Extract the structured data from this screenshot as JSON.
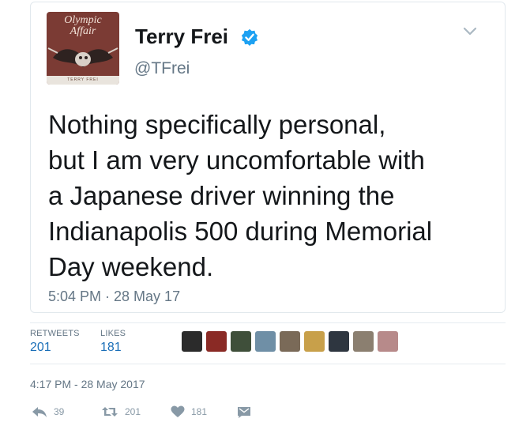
{
  "tweet": {
    "avatar": {
      "logo_text_line1": "Olympic",
      "logo_text_line2": "Affair",
      "footer_text": "TERRY FREI"
    },
    "display_name": "Terry Frei",
    "handle": "@TFrei",
    "verified": true,
    "text_lines": [
      "Nothing specifically personal,",
      "but I am very uncomfortable with",
      "a Japanese driver winning the",
      "Indianapolis 500 during Memorial",
      "Day weekend."
    ],
    "time": "5:04 PM · 28 May 17"
  },
  "stats": {
    "retweets_label": "RETWEETS",
    "retweets_value": "201",
    "likes_label": "LIKES",
    "likes_value": "181",
    "liker_avatars": [
      {
        "name": "liker-1",
        "color": "#2b2b2b"
      },
      {
        "name": "liker-2",
        "color": "#8a2a25"
      },
      {
        "name": "liker-3",
        "color": "#3f4f3a"
      },
      {
        "name": "liker-4",
        "color": "#6f8fa6"
      },
      {
        "name": "liker-5",
        "color": "#7a6a58"
      },
      {
        "name": "liker-6",
        "color": "#c8a04a"
      },
      {
        "name": "liker-7",
        "color": "#2e3640"
      },
      {
        "name": "liker-8",
        "color": "#8b7f70"
      },
      {
        "name": "liker-9",
        "color": "#b78a8a"
      }
    ]
  },
  "footer": {
    "timestamp": "4:17 PM - 28 May 2017",
    "reply_count": "39",
    "retweet_count": "201",
    "like_count": "181"
  },
  "colors": {
    "link_blue": "#1b6fb8",
    "muted_gray": "#657786",
    "icon_gray": "#8899a6",
    "verified_blue": "#1da1f2"
  }
}
